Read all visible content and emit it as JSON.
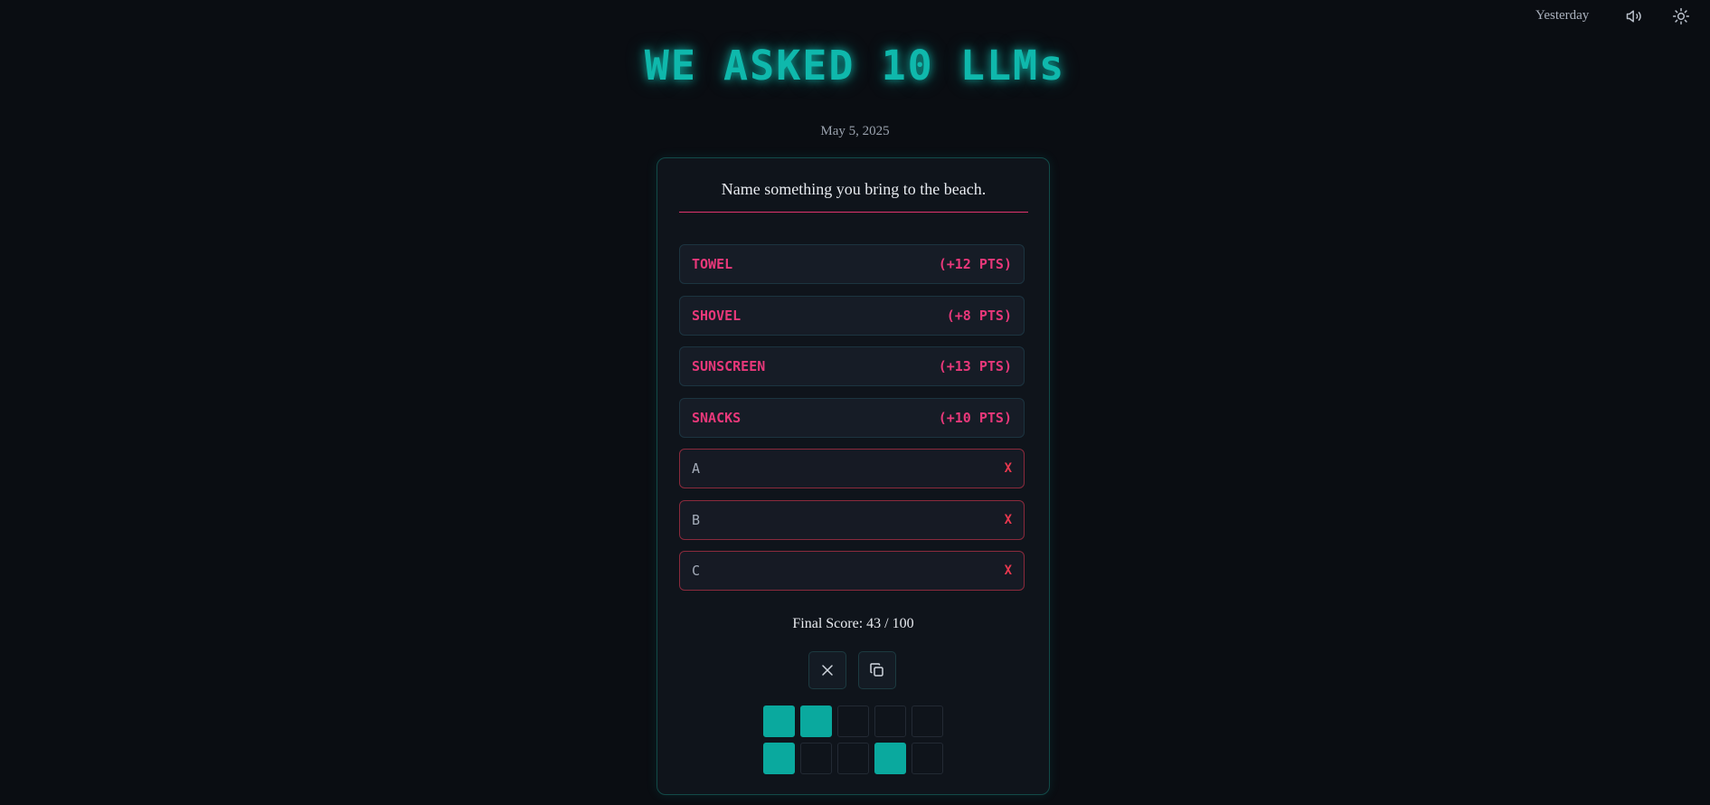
{
  "header": {
    "yesterday_label": "Yesterday",
    "sound_icon": "speaker-icon",
    "theme_icon": "sun-icon"
  },
  "title": "WE ASKED 10 LLMs",
  "date": "May 5, 2025",
  "question": "Name something you bring to the beach.",
  "answers": [
    {
      "label": "TOWEL",
      "points": "(+12 PTS)",
      "status": "correct"
    },
    {
      "label": "SHOVEL",
      "points": "(+8 PTS)",
      "status": "correct"
    },
    {
      "label": "SUNSCREEN",
      "points": "(+13 PTS)",
      "status": "correct"
    },
    {
      "label": "SNACKS",
      "points": "(+10 PTS)",
      "status": "correct"
    }
  ],
  "guesses": [
    {
      "label": "A",
      "mark": "X",
      "status": "wrong"
    },
    {
      "label": "B",
      "mark": "X",
      "status": "wrong"
    },
    {
      "label": "C",
      "mark": "X",
      "status": "wrong"
    }
  ],
  "final_score": "Final Score: 43 / 100",
  "actions": {
    "close_icon": "close-icon",
    "copy_icon": "copy-icon"
  },
  "result_grid": [
    [
      true,
      true,
      false,
      false,
      false
    ],
    [
      true,
      false,
      false,
      true,
      false
    ]
  ],
  "colors": {
    "accent_teal": "#0fb8ac",
    "accent_pink": "#e8387a",
    "wrong_red": "#e8384f",
    "background": "#0a0d12"
  }
}
